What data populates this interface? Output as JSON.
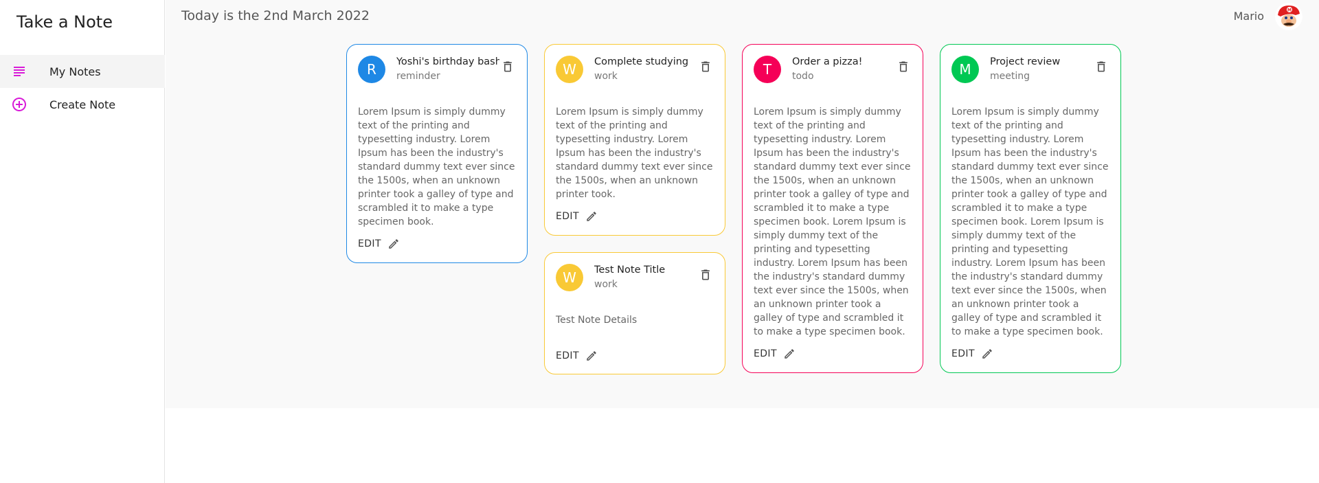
{
  "app": {
    "title": "Take a Note"
  },
  "sidebar": {
    "items": [
      {
        "label": "My Notes",
        "icon": "subject-icon"
      },
      {
        "label": "Create Note",
        "icon": "add-circle-icon"
      }
    ],
    "accent": "#d81ad8"
  },
  "topbar": {
    "date_text": "Today is the 2nd March 2022",
    "username": "Mario"
  },
  "notes": [
    {
      "initial": "R",
      "title": "Yoshi's birthday bash",
      "category": "reminder",
      "color": "#1e88e5",
      "details": "Lorem Ipsum is simply dummy text of the printing and typesetting industry. Lorem Ipsum has been the industry's standard dummy text ever since the 1500s, when an unknown printer took a galley of type and scrambled it to make a type specimen book.",
      "edit_label": "EDIT"
    },
    {
      "initial": "W",
      "title": "Complete studying",
      "category": "work",
      "color": "#f9c935",
      "details": "Lorem Ipsum is simply dummy text of the printing and typesetting industry. Lorem Ipsum has been the industry's standard dummy text ever since the 1500s, when an unknown printer took.",
      "edit_label": "EDIT"
    },
    {
      "initial": "W",
      "title": "Test Note Title",
      "category": "work",
      "color": "#f9c935",
      "details": "Test Note Details",
      "edit_label": "EDIT"
    },
    {
      "initial": "T",
      "title": "Order a pizza!",
      "category": "todo",
      "color": "#f50057",
      "details": "Lorem Ipsum is simply dummy text of the printing and typesetting industry. Lorem Ipsum has been the industry's standard dummy text ever since the 1500s, when an unknown printer took a galley of type and scrambled it to make a type specimen book. Lorem Ipsum is simply dummy text of the printing and typesetting industry. Lorem Ipsum has been the industry's standard dummy text ever since the 1500s, when an unknown printer took a galley of type and scrambled it to make a type specimen book.",
      "edit_label": "EDIT"
    },
    {
      "initial": "M",
      "title": "Project review",
      "category": "meeting",
      "color": "#00c853",
      "details": "Lorem Ipsum is simply dummy text of the printing and typesetting industry. Lorem Ipsum has been the industry's standard dummy text ever since the 1500s, when an unknown printer took a galley of type and scrambled it to make a type specimen book. Lorem Ipsum is simply dummy text of the printing and typesetting industry. Lorem Ipsum has been the industry's standard dummy text ever since the 1500s, when an unknown printer took a galley of type and scrambled it to make a type specimen book.",
      "edit_label": "EDIT"
    }
  ]
}
